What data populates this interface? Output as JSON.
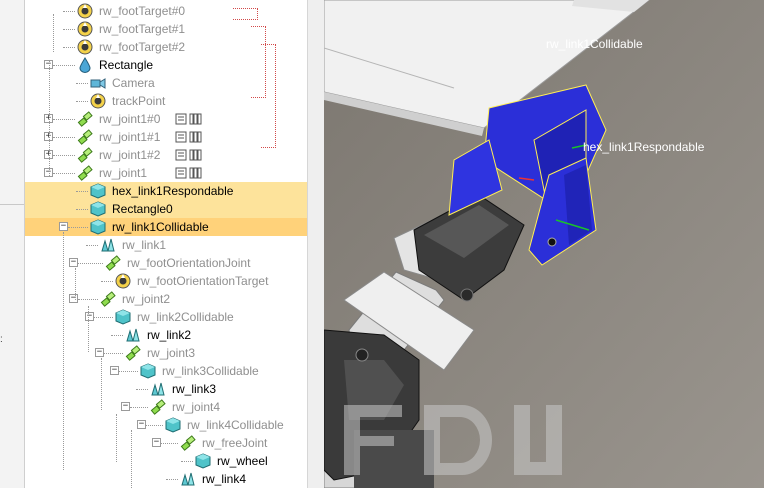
{
  "tree": {
    "rows": [
      {
        "label": "rw_footTarget#0",
        "greyed": true,
        "icon": "target-icon"
      },
      {
        "label": "rw_footTarget#1",
        "greyed": true,
        "icon": "target-icon"
      },
      {
        "label": "rw_footTarget#2",
        "greyed": true,
        "icon": "target-icon"
      },
      {
        "label": "Rectangle",
        "greyed": false,
        "icon": "dummy-drop-icon"
      },
      {
        "label": "Camera",
        "greyed": true,
        "icon": "camera-icon"
      },
      {
        "label": "trackPoint",
        "greyed": true,
        "icon": "target-icon"
      },
      {
        "label": "rw_joint1#0",
        "greyed": true,
        "icon": "joint-icon"
      },
      {
        "label": "rw_joint1#1",
        "greyed": true,
        "icon": "joint-icon"
      },
      {
        "label": "rw_joint1#2",
        "greyed": true,
        "icon": "joint-icon"
      },
      {
        "label": "rw_joint1",
        "greyed": true,
        "icon": "joint-icon"
      },
      {
        "label": "hex_link1Respondable",
        "greyed": false,
        "icon": "shape-icon"
      },
      {
        "label": "Rectangle0",
        "greyed": false,
        "icon": "shape-icon"
      },
      {
        "label": "rw_link1Collidable",
        "greyed": false,
        "icon": "shape-icon"
      },
      {
        "label": "rw_link1",
        "greyed": true,
        "icon": "link-icon"
      },
      {
        "label": "rw_footOrientationJoint",
        "greyed": true,
        "icon": "joint-icon"
      },
      {
        "label": "rw_footOrientationTarget",
        "greyed": true,
        "icon": "target-icon"
      },
      {
        "label": "rw_joint2",
        "greyed": true,
        "icon": "joint-icon"
      },
      {
        "label": "rw_link2Collidable",
        "greyed": true,
        "icon": "shape-icon"
      },
      {
        "label": "rw_link2",
        "greyed": false,
        "icon": "link-icon"
      },
      {
        "label": "rw_joint3",
        "greyed": true,
        "icon": "joint-icon"
      },
      {
        "label": "rw_link3Collidable",
        "greyed": true,
        "icon": "shape-icon"
      },
      {
        "label": "rw_link3",
        "greyed": false,
        "icon": "link-icon"
      },
      {
        "label": "rw_joint4",
        "greyed": true,
        "icon": "joint-icon"
      },
      {
        "label": "rw_link4Collidable",
        "greyed": true,
        "icon": "shape-icon"
      },
      {
        "label": "rw_freeJoint",
        "greyed": true,
        "icon": "joint-icon"
      },
      {
        "label": "rw_wheel",
        "greyed": false,
        "icon": "shape-icon"
      },
      {
        "label": "rw_link4",
        "greyed": false,
        "icon": "link-icon"
      }
    ]
  },
  "viewport": {
    "label_collidable": "rw_link1Collidable",
    "label_respondable": "hex_link1Respondable"
  },
  "colors": {
    "selection_light": "#fde39b",
    "selection_strong": "#ffd27a",
    "greyed_text": "#8f8f8f",
    "normal_text": "#000000",
    "link_marker": "#d24a4a",
    "selected_shape": "#2b2fd8"
  }
}
